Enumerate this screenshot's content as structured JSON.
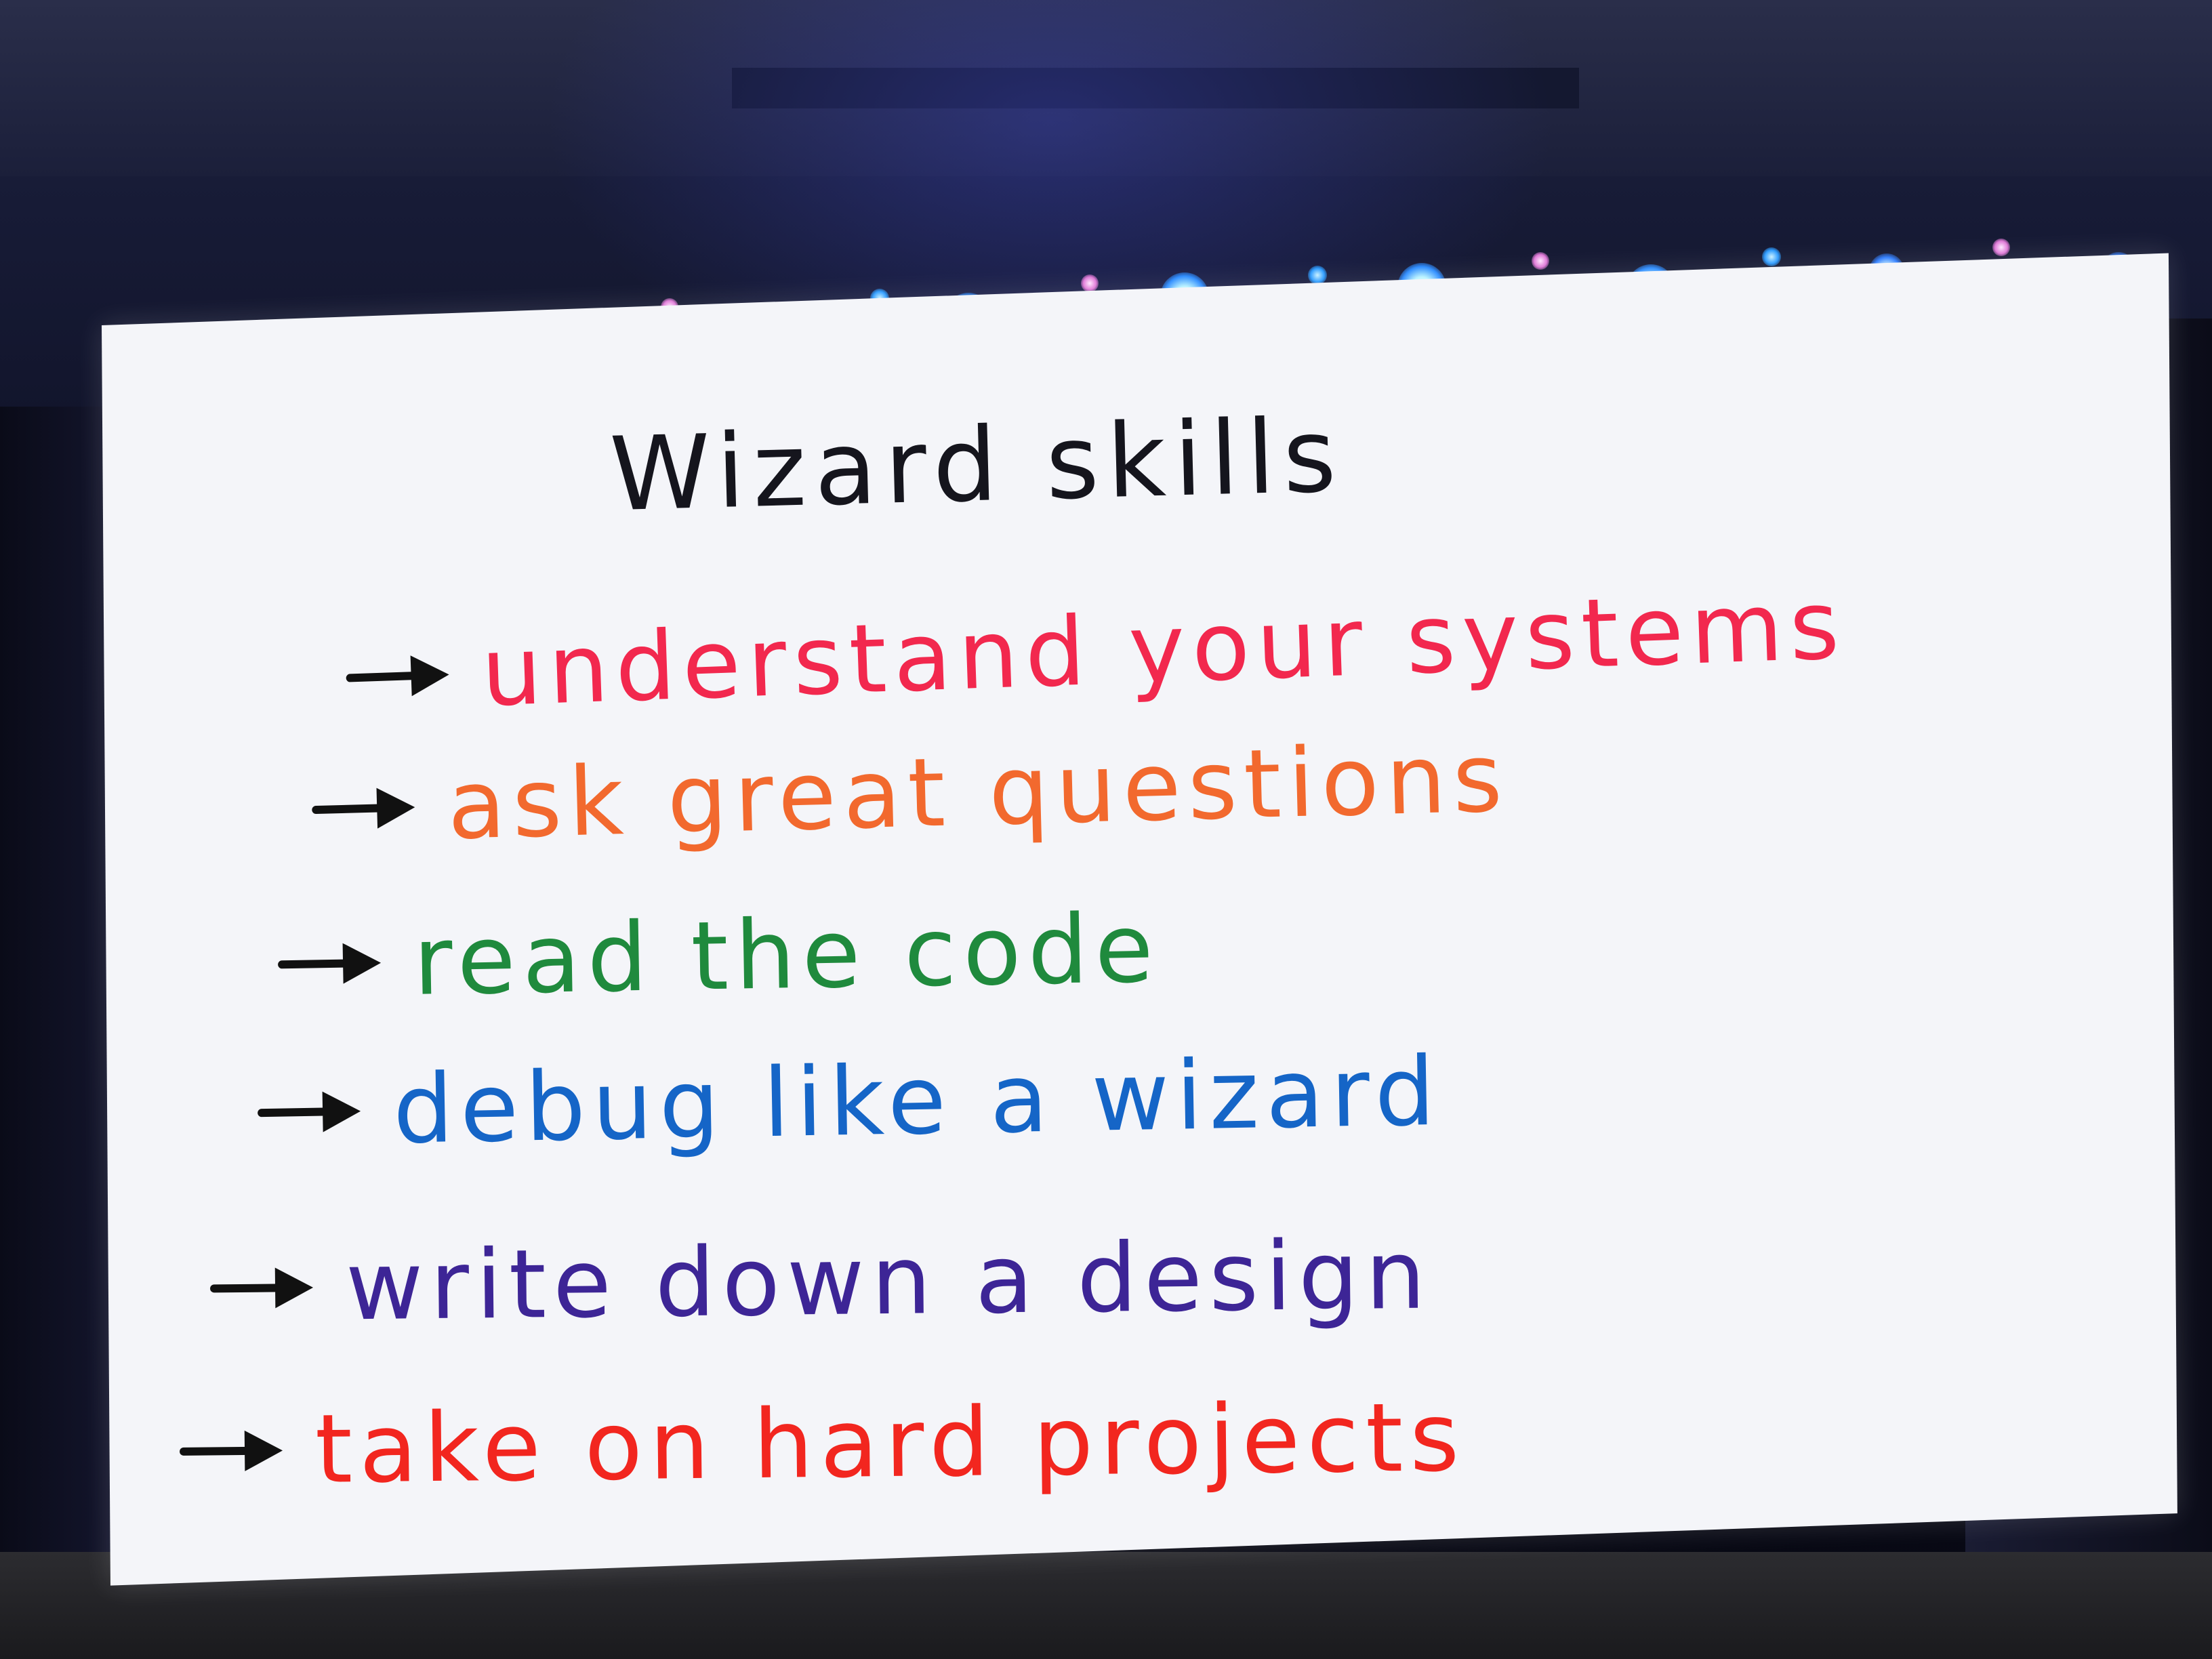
{
  "slide": {
    "title": "Wizard skills",
    "items": [
      {
        "text": "understand your systems",
        "color": "#f2284e"
      },
      {
        "text": "ask great questions",
        "color": "#f2692e"
      },
      {
        "text": "read the code",
        "color": "#1f8a3d"
      },
      {
        "text": "debug like a wizard",
        "color": "#1565c7"
      },
      {
        "text": "write down a design",
        "color": "#3d2596"
      },
      {
        "text": "take on hard projects",
        "color": "#f2261f"
      }
    ],
    "arrow_icon": "right-arrow-icon"
  },
  "colors": {
    "screen": "#f4f5f9",
    "stage_dark": "#0b0d22",
    "stage_light": "#2d7cff",
    "title_ink": "#15151d"
  }
}
